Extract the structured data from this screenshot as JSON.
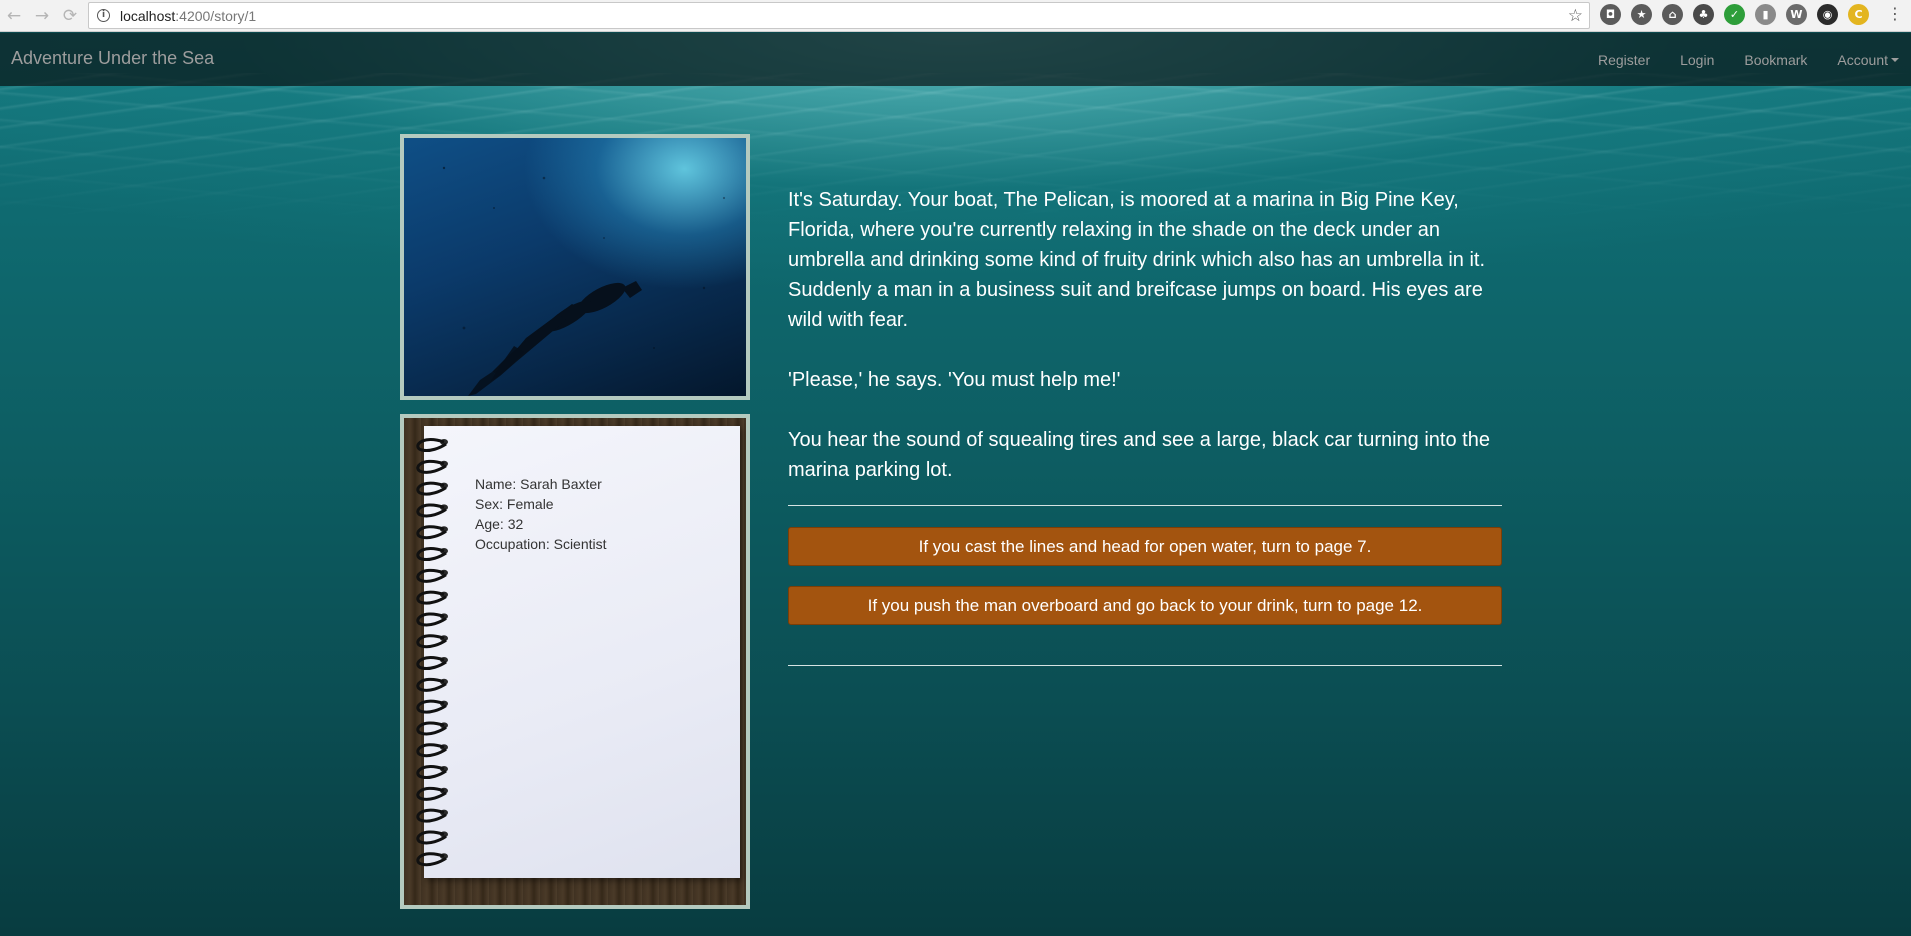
{
  "browser": {
    "url_host": "localhost",
    "url_path": ":4200/story/1",
    "back_glyph": "←",
    "forward_glyph": "→",
    "reload_glyph": "⟳",
    "info_glyph": "i",
    "star_glyph": "☆",
    "menu_glyph": "⋮",
    "extensions": [
      {
        "name": "pocket-icon",
        "color": "#5b5b5b",
        "glyph": "◘"
      },
      {
        "name": "star-plus-icon",
        "color": "#5b5b5b",
        "glyph": "★"
      },
      {
        "name": "map-pin-icon",
        "color": "#5b5b5b",
        "glyph": "⌂"
      },
      {
        "name": "evernote-icon",
        "color": "#4a4a4a",
        "glyph": "♣"
      },
      {
        "name": "checkmark-icon",
        "color": "#2e9e3a",
        "glyph": "✓"
      },
      {
        "name": "pdf-icon",
        "color": "#8a8a8a",
        "glyph": "▮"
      },
      {
        "name": "wappalyzer-icon",
        "color": "#6b6b6b",
        "glyph": "W"
      },
      {
        "name": "shield-icon",
        "color": "#2b2b2b",
        "glyph": "◉"
      },
      {
        "name": "cookie-icon",
        "color": "#e3b520",
        "glyph": "C"
      }
    ]
  },
  "navbar": {
    "brand": "Adventure Under the Sea",
    "links": [
      "Register",
      "Login",
      "Bookmark",
      "Account"
    ]
  },
  "character": {
    "name": "Name: Sarah Baxter",
    "sex": "Sex: Female",
    "age": "Age: 32",
    "occupation": "Occupation: Scientist"
  },
  "story": {
    "paragraphs": [
      "It's Saturday. Your boat, The Pelican, is moored at a marina in Big Pine Key, Florida, where you're currently relaxing in the shade on the deck under an umbrella and drinking some kind of fruity drink which also has an umbrella in it. Suddenly a man in a business suit and breifcase jumps on board. His eyes are wild with fear.",
      "'Please,' he says. 'You must help me!'",
      "You hear the sound of squealing tires and see a large, black car turning into the marina parking lot."
    ]
  },
  "choices": [
    "If you cast the lines and head for open water, turn to page 7.",
    "If you push the man overboard and go back to your drink, turn to page 12."
  ],
  "colors": {
    "choice_button": "#a3540f",
    "frame_border": "#b4cabf",
    "water": "#0d5e63"
  }
}
